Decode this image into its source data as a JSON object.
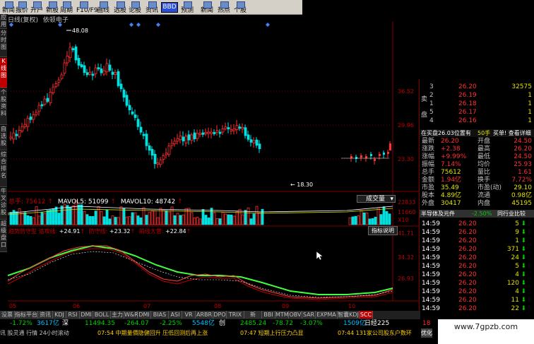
{
  "toolbar": {
    "items": [
      "新闻",
      "报价",
      "开户",
      "新股",
      "周期",
      "F10/F9",
      "画线",
      "选股",
      "论股堂",
      "资讯",
      "BBD",
      "预测",
      "新闻",
      "热点",
      "个股"
    ]
  },
  "left_tabs": [
    "应用",
    "分时图",
    "K线图",
    "个股资料",
    "自选股",
    "综合排名",
    "牛叉诊股",
    "超级盘口"
  ],
  "chart_header": {
    "period": "日线(复权)",
    "stock_name": "依顿电子",
    "high_label": "48.08",
    "low_label": "18.30"
  },
  "price_axis": [
    "36.52",
    "29.96",
    "23.30"
  ],
  "volume_legend": {
    "total": "总手: 75612",
    "ma5": "MAVOL5: 51099",
    "ma10": "MAVOL10: 48742",
    "dropdown": "成交量"
  },
  "volume_axis": [
    "22833",
    "11660",
    "X10"
  ],
  "indicator_legend": {
    "name": "趋势防守型 追攻线:",
    "v1": "+24.91",
    "l2": "防守线:",
    "v2": "+23.32",
    "l3": "前线大营:",
    "v3": "+22.84",
    "button": "指标说明"
  },
  "indicator_axis": [
    "41.71",
    "34.32",
    "26.93"
  ],
  "months": [
    "05",
    "06",
    "07",
    "08",
    "09",
    "10"
  ],
  "quote": {
    "sell": [
      {
        "level": "3",
        "price": "26.20",
        "vol": "32575"
      },
      {
        "level": "2",
        "price": "26.19",
        "vol": "1"
      },
      {
        "level": "1",
        "price": "26.18",
        "vol": "1"
      }
    ],
    "buy": [
      {
        "level": "5",
        "price": "26.17",
        "vol": "1"
      },
      {
        "level": "4",
        "price": "26.16",
        "vol": "1"
      }
    ],
    "sell_label": "卖",
    "buy_label": "盘",
    "bid_info": "在买盘26.03位置有",
    "bid_qty": "50手",
    "bid_action": "买单! 查看详细",
    "stats": [
      {
        "l1": "最新",
        "v1": "26.20",
        "l2": "开盘",
        "v2": "24.50"
      },
      {
        "l1": "涨跌",
        "v1": "+2.38",
        "l2": "最高",
        "v2": "26.20"
      },
      {
        "l1": "涨幅",
        "v1": "+9.99%",
        "l2": "最低",
        "v2": "24.50"
      },
      {
        "l1": "振幅",
        "v1": "7.14%",
        "l2": "均价",
        "v2": "25.93"
      },
      {
        "l1": "总手",
        "v1": "75612",
        "l2": "量比",
        "v2": "1.61"
      },
      {
        "l1": "金额",
        "v1": "1.94亿",
        "l2": "换手",
        "v2": "7.72%"
      },
      {
        "l1": "市盈",
        "v1": "35.49",
        "l2": "市盈(动)",
        "v2": "29.10"
      },
      {
        "l1": "股本",
        "v1": "4.89亿",
        "l2": "流通",
        "v2": "0.98亿"
      },
      {
        "l1": "外盘",
        "v1": "30417",
        "l2": "内盘",
        "v2": "45195"
      }
    ],
    "bar_left": "半导体及元件",
    "bar_pct": "-2.50%",
    "bar_right": "同行业比较",
    "trades": [
      {
        "t": "14:59",
        "p": "26.20",
        "v": "5"
      },
      {
        "t": "14:59",
        "p": "26.20",
        "v": "9"
      },
      {
        "t": "14:59",
        "p": "26.20",
        "v": "1"
      },
      {
        "t": "14:59",
        "p": "26.20",
        "v": "371"
      },
      {
        "t": "14:59",
        "p": "26.20",
        "v": "24"
      },
      {
        "t": "14:59",
        "p": "26.20",
        "v": "5"
      },
      {
        "t": "14:59",
        "p": "26.20",
        "v": "4"
      },
      {
        "t": "14:59",
        "p": "26.20",
        "v": "120"
      },
      {
        "t": "14:59",
        "p": "26.20",
        "v": "4"
      },
      {
        "t": "14:59",
        "p": "26.20",
        "v": "11"
      },
      {
        "t": "14:59",
        "p": "26.20",
        "v": "22"
      }
    ]
  },
  "bottom_tabs": [
    "KDJ",
    "RSI",
    "DMI",
    "BOLL",
    "主力",
    "W&R",
    "DMI",
    "BIAS",
    "ASI",
    "VR",
    "ARBR",
    "DPO",
    "TRIX",
    "新DMA",
    "BBI",
    "MTM",
    "OBV",
    "SAR",
    "EXPMA",
    "智囊KDJ",
    "SCC"
  ],
  "bottom_left_tabs": [
    "没票",
    "指标平台",
    "资讯"
  ],
  "status": {
    "idx1": "-1.72%",
    "idx2": "3617亿",
    "idx2b": "深",
    "idx3": "11494.35",
    "idx4": "-264.07",
    "idx5": "-2.25%",
    "idx6": "5548亿",
    "idx6b": "创",
    "idx7": "2485.24",
    "idx8": "-78.72",
    "idx9": "-3.07%",
    "idx10": "1509亿",
    "idx10b": "日经225",
    "idx11": "18"
  },
  "ticker": {
    "left": "讯 股灵通 行情 24小时滚动",
    "n1": "07:54 中期量價隐健回升 压低回测后再上涨",
    "n2": "07:47 短期上行压力凸显",
    "n3": "07:44 131家公司股东户数环",
    "tail": "优化"
  },
  "watermark": "www.7gpzb.com"
}
